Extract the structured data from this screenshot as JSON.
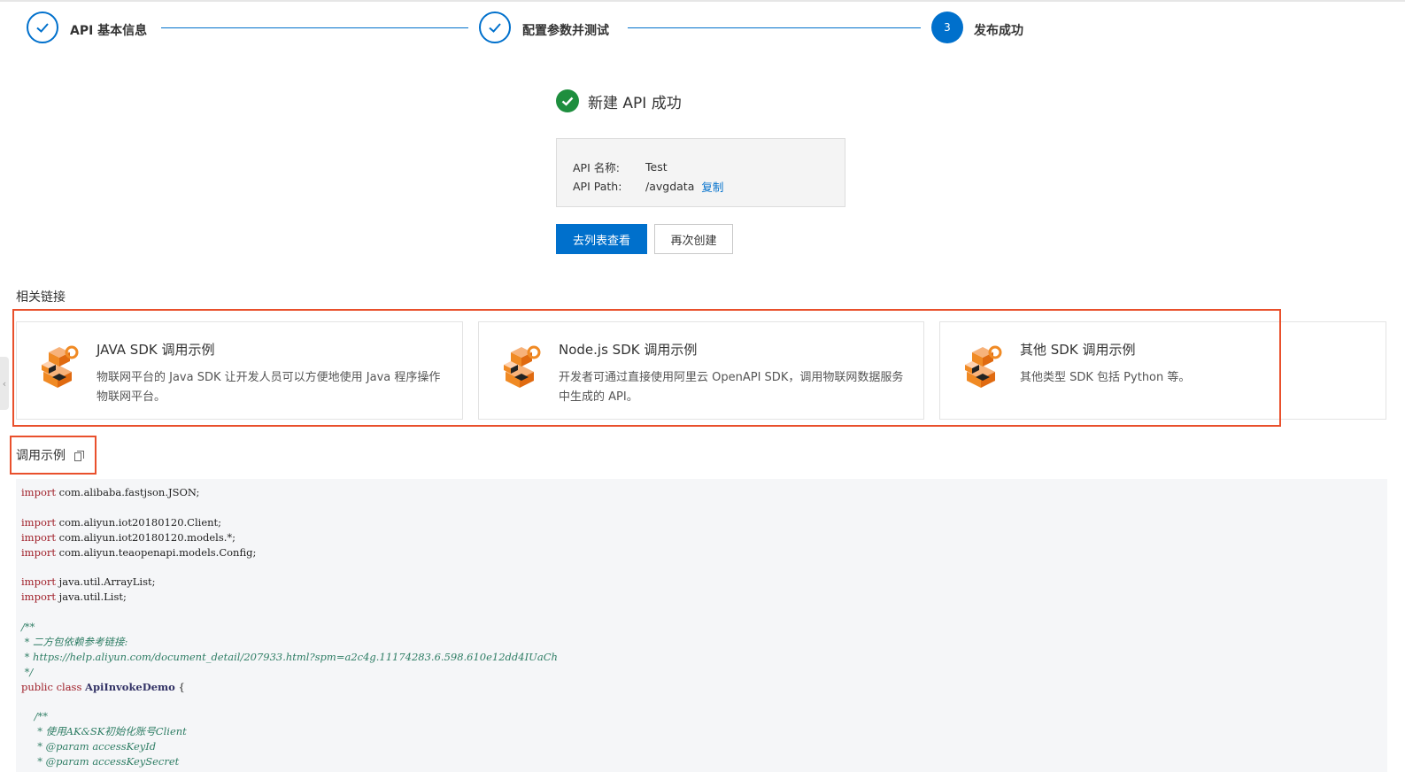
{
  "steps": [
    {
      "label": "API 基本信息",
      "status": "done"
    },
    {
      "label": "配置参数并测试",
      "status": "done"
    },
    {
      "label": "发布成功",
      "status": "active",
      "number": "3"
    }
  ],
  "success": {
    "title": "新建 API 成功",
    "name_key": "API 名称:",
    "name_value": "Test",
    "path_key": "API Path:",
    "path_value": "/avgdata",
    "copy_label": "复制"
  },
  "buttons": {
    "go_list": "去列表查看",
    "create_again": "再次创建"
  },
  "related": {
    "title": "相关链接",
    "cards": [
      {
        "title": "JAVA SDK 调用示例",
        "desc": "物联网平台的 Java SDK 让开发人员可以方便地使用 Java 程序操作物联网平台。"
      },
      {
        "title": "Node.js SDK 调用示例",
        "desc": "开发者可通过直接使用阿里云 OpenAPI SDK，调用物联网数据服务中生成的 API。"
      },
      {
        "title": "其他 SDK 调用示例",
        "desc": "其他类型 SDK 包括 Python 等。"
      }
    ]
  },
  "example": {
    "title": "调用示例",
    "code": {
      "l1_kw": "import",
      "l1": " com.alibaba.fastjson.JSON;",
      "l3_kw": "import",
      "l3": " com.aliyun.iot20180120.Client;",
      "l4_kw": "import",
      "l4": " com.aliyun.iot20180120.models.*;",
      "l5_kw": "import",
      "l5": " com.aliyun.teaopenapi.models.Config;",
      "l7_kw": "import",
      "l7": " java.util.ArrayList;",
      "l8_kw": "import",
      "l8": " java.util.List;",
      "l10": "/**",
      "l11": " * 二方包依赖参考链接:",
      "l12": " * https://help.aliyun.com/document_detail/207933.html?spm=a2c4g.11174283.6.598.610e12dd4IUaCh",
      "l13": " */",
      "l14_a": "public class ",
      "l14_b": "ApiInvokeDemo",
      "l14_c": " {",
      "l16": "    /**",
      "l17": "     * 使用AK&SK初始化账号Client",
      "l18": "     * @param accessKeyId",
      "l19": "     * @param accessKeySecret"
    }
  },
  "colors": {
    "primary": "#0070cc",
    "success": "#1e8e3e",
    "highlight": "#e9502c",
    "icon_orange": "#f08a24"
  }
}
